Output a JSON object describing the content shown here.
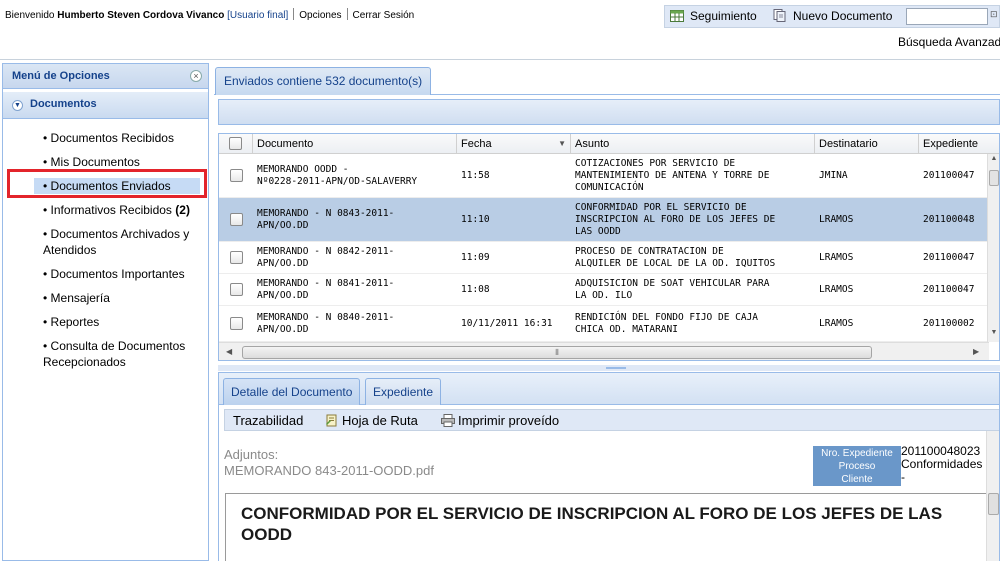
{
  "header": {
    "welcome_prefix": "Bienvenido",
    "user_name": "Humberto Steven Cordova Vivanco",
    "user_role": "[Usuario final]",
    "options_link": "Opciones",
    "logout_link": "Cerrar Sesión"
  },
  "toolbar": {
    "tracking_label": "Seguimiento",
    "new_document_label": "Nuevo Documento",
    "search_value": "",
    "advanced_search_label": "Búsqueda Avanzada"
  },
  "sidebar": {
    "title": "Menú de Opciones",
    "section_title": "Documentos",
    "items": [
      {
        "label": "Documentos Recibidos",
        "count": ""
      },
      {
        "label": "Mis Documentos",
        "count": ""
      },
      {
        "label": "Documentos Enviados",
        "count": "",
        "selected": true
      },
      {
        "label": "Informativos Recibidos",
        "count": "(2)"
      },
      {
        "label": "Documentos Archivados y Atendidos",
        "count": ""
      },
      {
        "label": "Documentos Importantes",
        "count": ""
      },
      {
        "label": "Mensajería",
        "count": ""
      },
      {
        "label": "Reportes",
        "count": ""
      },
      {
        "label": "Consulta de Documentos Recepcionados",
        "count": ""
      }
    ]
  },
  "main": {
    "tab_label": "Enviados contiene 532 documento(s)",
    "grid": {
      "columns": [
        "Documento",
        "Fecha",
        "Asunto",
        "Destinatario",
        "Expediente"
      ],
      "rows": [
        {
          "documento": "MEMORANDO OODD -\nNº0228-2011-APN/OD-SALAVERRY",
          "fecha": "11:58",
          "asunto": "COTIZACIONES POR SERVICIO DE\nMANTENIMIENTO DE ANTENA Y TORRE DE\nCOMUNICACIÓN",
          "destinatario": "JMINA",
          "expediente": "201100047",
          "selected": false
        },
        {
          "documento": "MEMORANDO - N 0843-2011-\nAPN/OO.DD",
          "fecha": "11:10",
          "asunto": "CONFORMIDAD POR EL SERVICIO DE\nINSCRIPCION AL FORO DE LOS JEFES DE\nLAS OODD",
          "destinatario": "LRAMOS",
          "expediente": "201100048",
          "selected": true
        },
        {
          "documento": "MEMORANDO - N 0842-2011-\nAPN/OO.DD",
          "fecha": "11:09",
          "asunto": "PROCESO DE CONTRATACION DE\nALQUILER DE LOCAL DE LA OD. IQUITOS",
          "destinatario": "LRAMOS",
          "expediente": "201100047",
          "selected": false
        },
        {
          "documento": "MEMORANDO - N 0841-2011-\nAPN/OO.DD",
          "fecha": "11:08",
          "asunto": "ADQUISICION DE SOAT VEHICULAR PARA\nLA OD. ILO",
          "destinatario": "LRAMOS",
          "expediente": "201100047",
          "selected": false
        },
        {
          "documento": "MEMORANDO - N 0840-2011-\nAPN/OO.DD",
          "fecha": "10/11/2011 16:31",
          "asunto": "RENDICIÓN DEL FONDO FIJO DE CAJA\nCHICA OD. MATARANI",
          "destinatario": "LRAMOS",
          "expediente": "201100002",
          "selected": false
        }
      ]
    }
  },
  "detail": {
    "tabs": [
      "Detalle del Documento",
      "Expediente"
    ],
    "buttons": [
      "Trazabilidad",
      "Hoja de Ruta",
      "Imprimir proveído"
    ],
    "attachments_label": "Adjuntos:",
    "attachment_file": "MEMORANDO 843-2011-OODD.pdf",
    "expediente_label_lines": [
      "Nro. Expediente",
      "Proceso",
      "Cliente"
    ],
    "expediente_values": [
      "201100048023",
      "Conformidades",
      "-"
    ],
    "document_title": "CONFORMIDAD POR EL SERVICIO DE INSCRIPCION AL FORO DE LOS JEFES DE LAS OODD"
  },
  "colors": {
    "accent": "#15428b",
    "panel_border": "#99bbe8",
    "selected_row": "#b9cde5",
    "highlight_box": "#e3242b"
  }
}
